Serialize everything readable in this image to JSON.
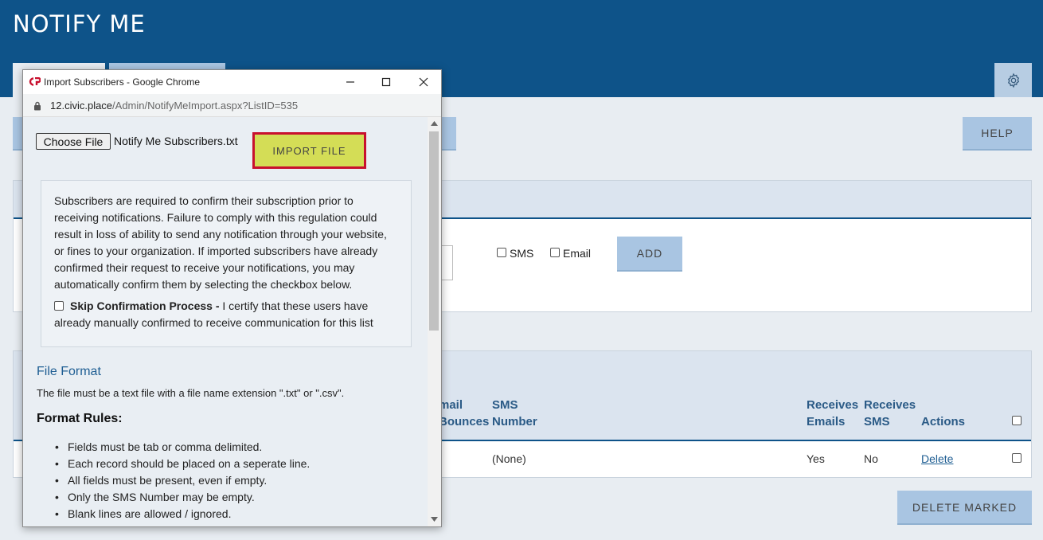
{
  "app": {
    "title": "NOTIFY ME"
  },
  "toolbar": {
    "help_label": "HELP"
  },
  "add_form": {
    "sms_label": "SMS",
    "email_label": "Email",
    "add_label": "ADD"
  },
  "table": {
    "headers": {
      "email_bounces": [
        "mail",
        "Bounces"
      ],
      "sms_number": [
        "SMS",
        "Number"
      ],
      "receives_emails": [
        "Receives",
        "Emails"
      ],
      "receives_sms": [
        "Receives",
        "SMS"
      ],
      "actions": "Actions"
    },
    "row": {
      "sms_number": "(None)",
      "receives_emails": "Yes",
      "receives_sms": "No",
      "action": "Delete"
    },
    "delete_marked_label": "DELETE MARKED"
  },
  "popup": {
    "window_title": "Import Subscribers - Google Chrome",
    "url_host": "12.civic.place",
    "url_path": "/Admin/NotifyMeImport.aspx?ListID=535",
    "choose_file_label": "Choose File",
    "file_name": "Notify Me Subscribers.txt",
    "import_label": "IMPORT FILE",
    "notice_text": "Subscribers are required to confirm their subscription prior to receiving notifications. Failure to comply with this regulation could result in loss of ability to send any notification through your website, or fines to your organization. If imported subscribers have already confirmed their request to receive your notifications, you may automatically confirm them by selecting the checkbox below.",
    "skip_label": "Skip Confirmation Process -",
    "skip_desc": " I certify that these users have already manually confirmed to receive communication for this list",
    "file_format_heading": "File Format",
    "file_format_text": "The file must be a text file with a file name extension \".txt\" or \".csv\".",
    "format_rules_heading": "Format Rules:",
    "rules": [
      "Fields must be tab or comma delimited.",
      "Each record should be placed on a seperate line.",
      "All fields must be present, even if empty.",
      "Only the SMS Number may be empty.",
      "Blank lines are allowed / ignored."
    ]
  }
}
